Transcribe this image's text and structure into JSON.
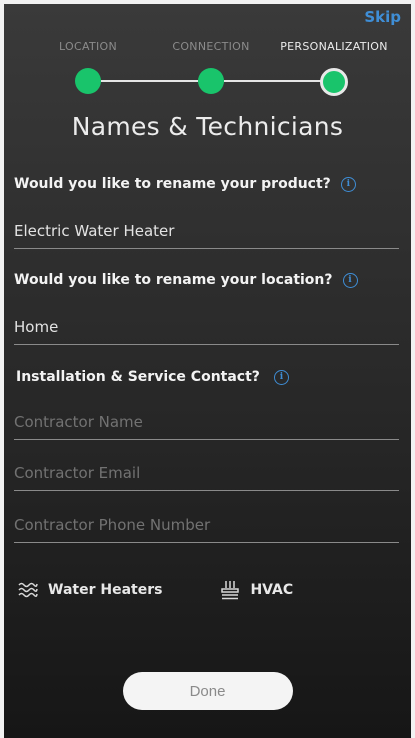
{
  "header": {
    "skip_label": "Skip"
  },
  "steps": [
    {
      "label": "LOCATION",
      "state": "completed"
    },
    {
      "label": "CONNECTION",
      "state": "completed"
    },
    {
      "label": "PERSONALIZATION",
      "state": "current"
    }
  ],
  "page_title": "Names & Technicians",
  "product": {
    "question": "Would you like to rename your product?",
    "value": "Electric Water Heater"
  },
  "location": {
    "question": "Would you like to rename your location?",
    "value": "Home"
  },
  "contact": {
    "question": "Installation & Service Contact?",
    "name_placeholder": "Contractor Name",
    "email_placeholder": "Contractor Email",
    "phone_placeholder": "Contractor Phone Number"
  },
  "categories": [
    {
      "label": "Water Heaters",
      "icon": "water-heater-icon"
    },
    {
      "label": "HVAC",
      "icon": "hvac-icon"
    }
  ],
  "done_label": "Done",
  "colors": {
    "accent_blue": "#3f8ed6",
    "step_green": "#19c46b"
  }
}
